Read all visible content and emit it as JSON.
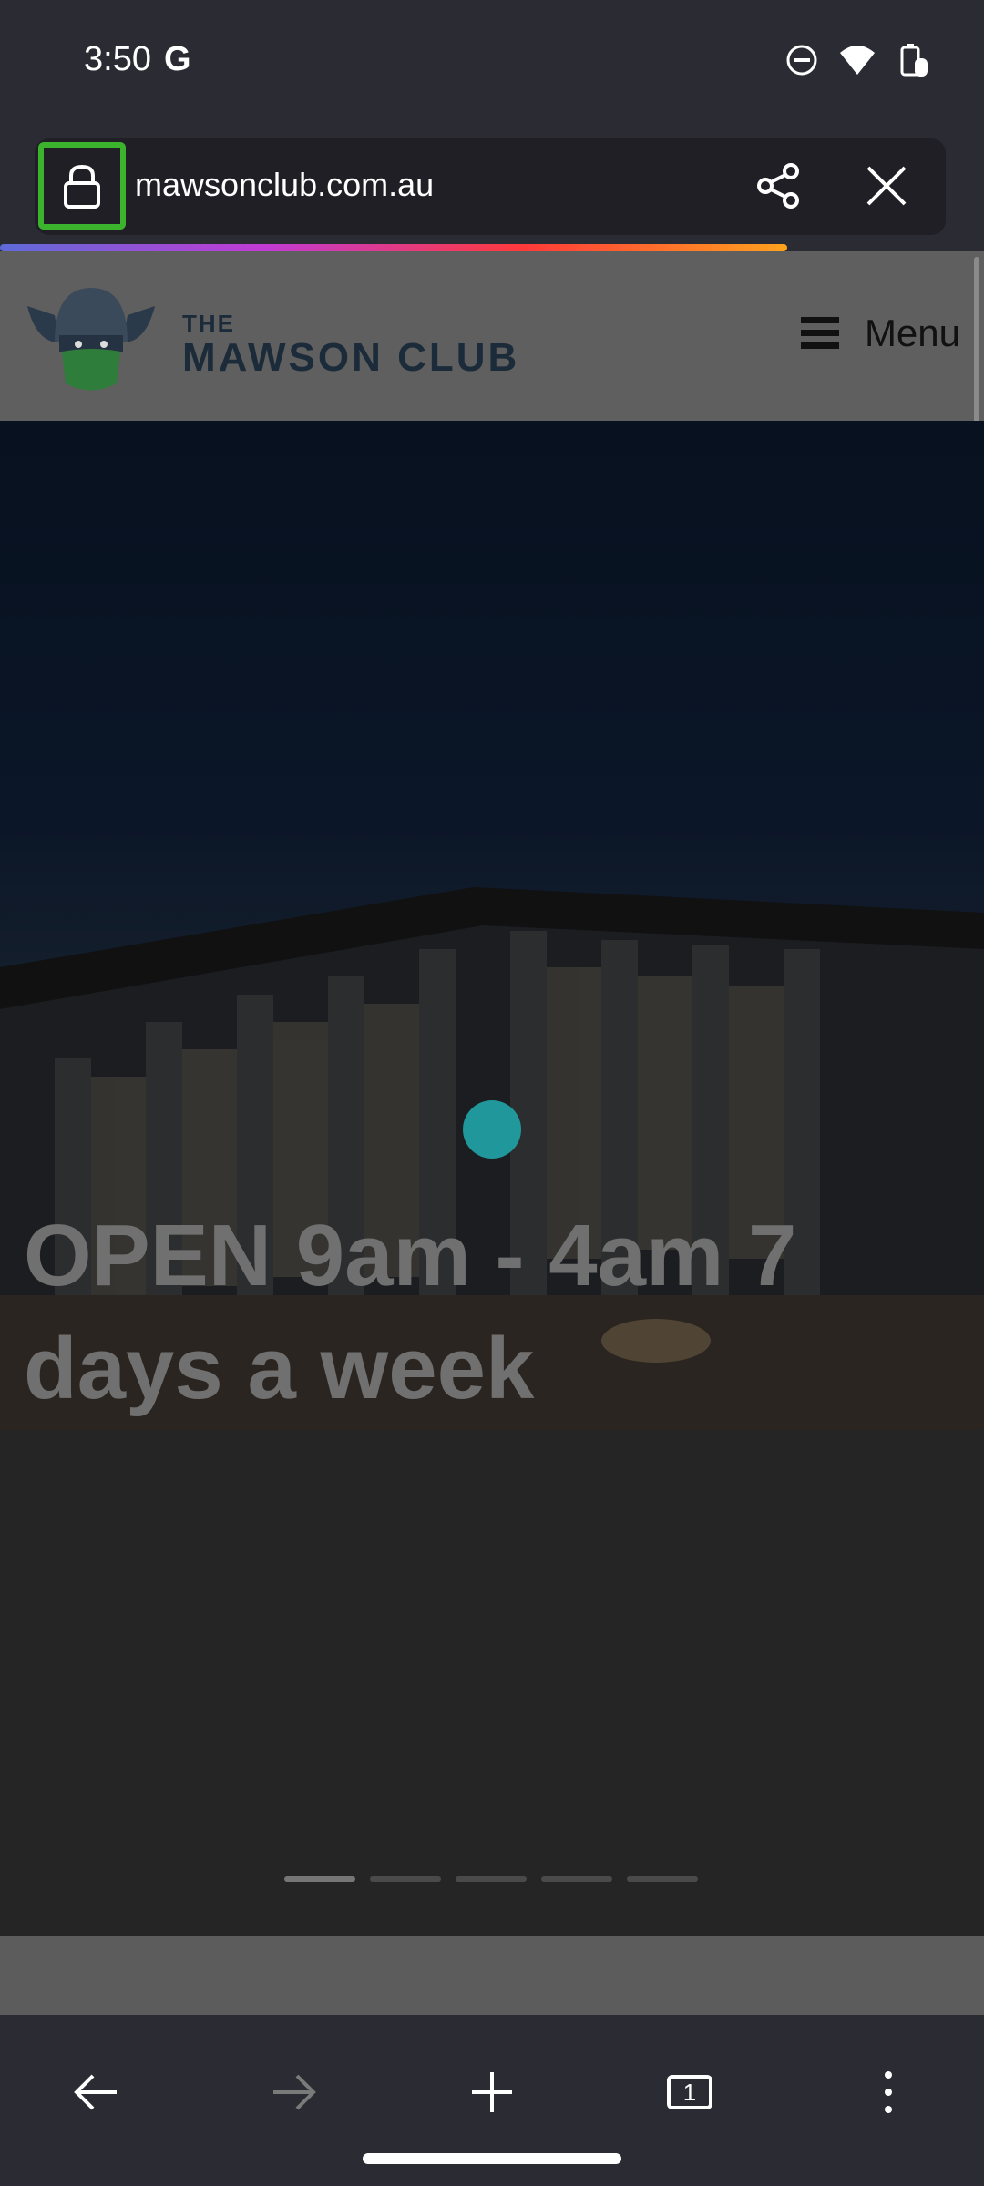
{
  "status_bar": {
    "time": "3:50",
    "google_badge": "G",
    "icons": [
      "do-not-disturb-icon",
      "wifi-icon",
      "battery-icon"
    ]
  },
  "browser": {
    "url": "mawsonclub.com.au",
    "lock_icon": "lock-icon",
    "share_icon": "share-icon",
    "close_icon": "close-icon",
    "progress_colors": [
      "#5e6bd8",
      "#c13bd5",
      "#ff3a3a",
      "#ffa21e"
    ]
  },
  "site": {
    "brand_small": "THE",
    "brand_large": "MAWSON CLUB",
    "menu_label": "Menu",
    "hero_title": "OPEN 9am - 4am 7 days a week",
    "slider_count": 5,
    "slider_active_index": 0
  },
  "bottom_nav": {
    "back_icon": "back-arrow-icon",
    "forward_icon": "forward-arrow-icon",
    "new_tab_icon": "plus-icon",
    "tab_count": "1",
    "more_icon": "more-vertical-icon"
  },
  "colors": {
    "accent_lock_border": "#3cb32c",
    "hero_dot": "#20a5a9"
  }
}
